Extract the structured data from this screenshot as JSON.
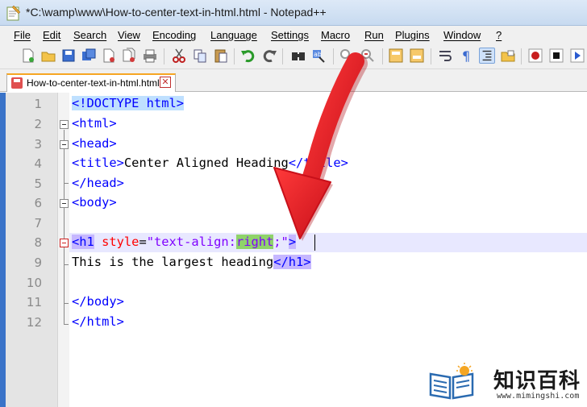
{
  "window": {
    "title": "*C:\\wamp\\www\\How-to-center-text-in-html.html - Notepad++",
    "app_icon": "notepad-plus-plus-icon"
  },
  "menu": [
    "File",
    "Edit",
    "Search",
    "View",
    "Encoding",
    "Language",
    "Settings",
    "Macro",
    "Run",
    "Plugins",
    "Window",
    "?"
  ],
  "toolbar_icons": [
    "new-file-icon",
    "open-file-icon",
    "save-icon",
    "save-all-icon",
    "close-icon",
    "close-all-icon",
    "print-icon",
    "cut-icon",
    "copy-icon",
    "paste-icon",
    "undo-icon",
    "redo-icon",
    "find-icon",
    "replace-icon",
    "zoom-in-icon",
    "zoom-out-icon",
    "sync-v-icon",
    "sync-h-icon",
    "wrap-icon",
    "show-all-chars-icon",
    "indent-guide-icon",
    "folder-icon",
    "record-macro-icon",
    "stop-macro-icon",
    "play-macro-icon"
  ],
  "tab": {
    "label": "How-to-center-text-in-html.html",
    "close_label": "✕"
  },
  "editor": {
    "line_numbers": [
      "1",
      "2",
      "3",
      "4",
      "5",
      "6",
      "7",
      "8",
      "9",
      "10",
      "11",
      "12"
    ],
    "lines": {
      "l1_doctype": "<!DOCTYPE html>",
      "l2_open": "<",
      "l2_name": "html",
      "l2_close": ">",
      "l3_open": "<",
      "l3_name": "head",
      "l3_close": ">",
      "l4_open1": "<",
      "l4_name1": "title",
      "l4_close1": ">",
      "l4_text": "Center Aligned Heading",
      "l4_open2": "</",
      "l4_name2": "title",
      "l4_close2": ">",
      "l5_open": "</",
      "l5_name": "head",
      "l5_close": ">",
      "l6_open": "<",
      "l6_name": "body",
      "l6_close": ">",
      "l8_open": "<",
      "l8_name": "h1",
      "l8_attr": "style",
      "l8_eq": "=",
      "l8_val_a": "\"text-align:",
      "l8_val_b": "right",
      "l8_val_c": ";\"",
      "l8_close": ">",
      "l9_text": "This is the largest heading",
      "l9_open": "</",
      "l9_name": "h1",
      "l9_close": ">",
      "l11_open": "</",
      "l11_name": "body",
      "l11_close": ">",
      "l12_open": "</",
      "l12_name": "html",
      "l12_close": ">"
    }
  },
  "watermark": {
    "logo_icon": "book-lightbulb-icon",
    "text": "知识百科",
    "url": "www.mimingshi.com"
  },
  "colors": {
    "tag": "#0000ff",
    "attribute": "#ff0000",
    "value": "#8000ff",
    "arrow": "#e8141e",
    "selection_highlight": "#8fd36a",
    "tag_match_highlight": "#c6b7ff"
  }
}
